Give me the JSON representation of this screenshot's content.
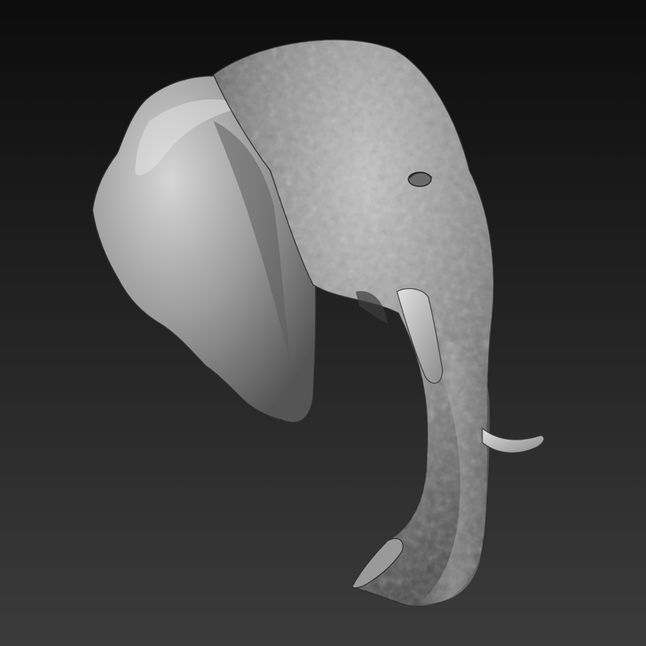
{
  "scene": {
    "subject": "sculpted-elephant-head",
    "colors": {
      "background_top": "#0c0c0c",
      "background_bottom": "#3b3b3b",
      "material_light": "#d8d8d8",
      "material_mid": "#8e8e8e",
      "material_dark": "#3a3a3a",
      "tusk": "#c9c9c9"
    }
  }
}
